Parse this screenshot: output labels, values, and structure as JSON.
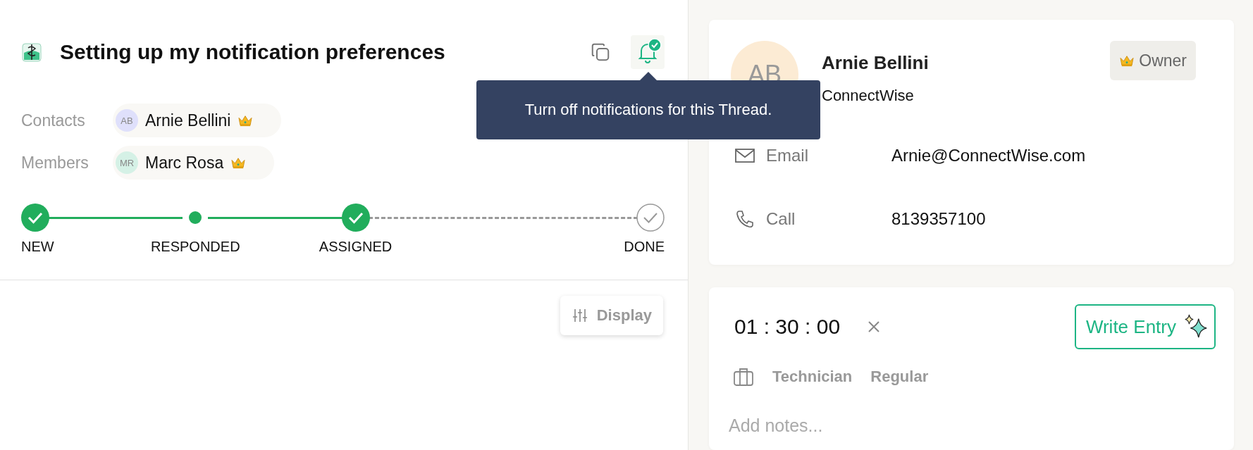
{
  "thread": {
    "title": "Setting up my notification preferences",
    "notifications_on": true
  },
  "tooltip": {
    "text": "Turn off notifications for this Thread."
  },
  "people": [
    {
      "label": "Contacts",
      "initials": "AB",
      "name": "Arnie Bellini",
      "owner": true,
      "color": "#dfe0fb"
    },
    {
      "label": "Members",
      "initials": "MR",
      "name": "Marc Rosa",
      "owner": true,
      "color": "#d5f1e6"
    }
  ],
  "steps": [
    {
      "label": "NEW",
      "reached": true,
      "done": true
    },
    {
      "label": "RESPONDED",
      "reached": true,
      "done": false
    },
    {
      "label": "ASSIGNED",
      "reached": true,
      "done": true
    },
    {
      "label": "DONE",
      "reached": false,
      "done": false
    }
  ],
  "display_button": {
    "label": "Display"
  },
  "contact_card": {
    "initials": "AB",
    "name": "Arnie Bellini",
    "company": "ConnectWise",
    "role_badge": "Owner",
    "fields": [
      {
        "kind": "email",
        "label": "Email",
        "value": "Arnie@ConnectWise.com"
      },
      {
        "kind": "call",
        "label": "Call",
        "value": "8139357100"
      }
    ]
  },
  "time_entry": {
    "timer": "01 : 30 : 00",
    "write_button": "Write Entry",
    "work_role": "Technician",
    "work_type": "Regular",
    "notes_placeholder": "Add notes..."
  }
}
